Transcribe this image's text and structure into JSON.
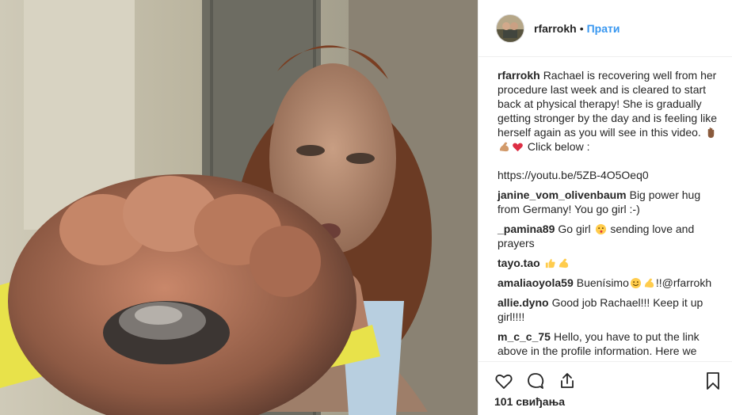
{
  "post": {
    "username": "rfarrokh",
    "separator": "•",
    "follow_label": "Прати",
    "likes": "101 свиђања"
  },
  "caption": {
    "user": "rfarrokh",
    "text": "Rachael is recovering well from her procedure last week and is cleared to start back at physical therapy! She is gradually getting stronger by the day and is feeling like herself again as you will see in this video. ",
    "after_emoji": " Click below :",
    "link": "https://youtu.be/5ZB-4O5Oeq0"
  },
  "comments": [
    {
      "user": "janine_vom_olivenbaum",
      "text": "Big power hug from Germany! You go girl :-)"
    },
    {
      "user": "_pamina89",
      "text_before": "Go girl ",
      "text_after": " sending love and prayers"
    },
    {
      "user": "tayo.tao"
    },
    {
      "user": "amaliaoyola59",
      "text_before": "Buenísimo",
      "text_after": "!!@rfarrokh"
    },
    {
      "user": "allie.dyno",
      "text": "Good job Rachael!!! Keep it up girl!!!!"
    },
    {
      "user": "m_c_c_75",
      "text": "Hello, you have to put the link above in the profile information. Here we"
    }
  ],
  "icons": {
    "like": "heart-icon",
    "comment": "comment-icon",
    "share": "share-icon",
    "save": "bookmark-icon"
  },
  "colors": {
    "follow": "#3897f0",
    "text": "#262626",
    "border": "#efefef"
  }
}
